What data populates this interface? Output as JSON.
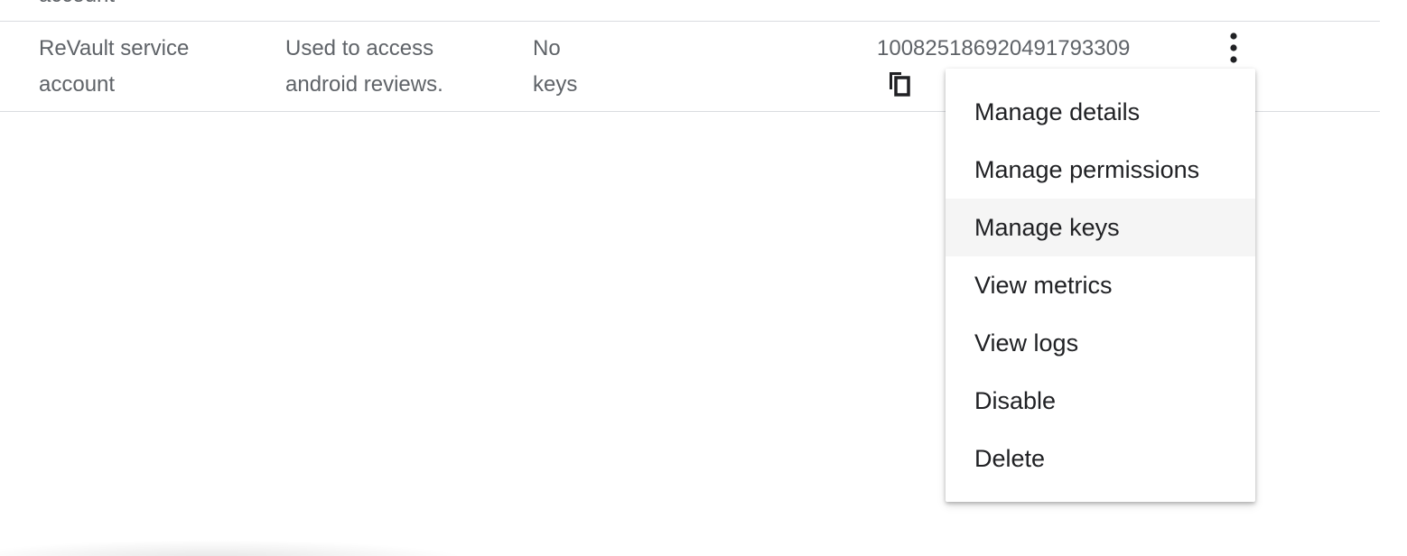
{
  "previous_row": {
    "name_fragment": "account"
  },
  "row": {
    "name": "ReVault service\naccount",
    "description": "Used to access\nandroid reviews.",
    "keys": "No\nkeys",
    "unique_id": "100825186920491793309"
  },
  "icons": {
    "copy": "copy-icon",
    "more": "more-vert-icon"
  },
  "menu": {
    "items": [
      {
        "label": "Manage details",
        "hovered": false
      },
      {
        "label": "Manage permissions",
        "hovered": false
      },
      {
        "label": "Manage keys",
        "hovered": true
      },
      {
        "label": "View metrics",
        "hovered": false
      },
      {
        "label": "View logs",
        "hovered": false
      },
      {
        "label": "Disable",
        "hovered": false
      },
      {
        "label": "Delete",
        "hovered": false
      }
    ]
  },
  "colors": {
    "text_secondary": "#5f6368",
    "text_primary": "#202124",
    "divider": "#dadce0",
    "hover": "#f5f5f5"
  }
}
